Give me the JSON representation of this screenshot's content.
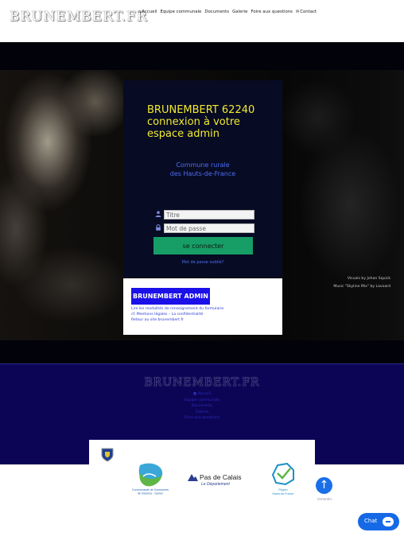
{
  "header": {
    "logo": "BRUNEMBERT.FR",
    "nav": [
      {
        "icon": "home-icon",
        "glyph": "⌂",
        "label": "Accueil"
      },
      {
        "icon": "",
        "glyph": "",
        "label": "Equipe communale"
      },
      {
        "icon": "",
        "glyph": "",
        "label": "Documents"
      },
      {
        "icon": "",
        "glyph": "",
        "label": "Galerie"
      },
      {
        "icon": "",
        "glyph": "",
        "label": "Foire aux questions"
      },
      {
        "icon": "mail-icon",
        "glyph": "✉",
        "label": "Contact"
      }
    ]
  },
  "hero": {
    "credit_visuals": "Visuals by Johan Squick",
    "credit_music": "Music \"Skyline Mix\" by Lavoard"
  },
  "login": {
    "title": "BRUNEMBERT 62240 connexion à votre espace admin",
    "subtitle_line1": "Commune rurale",
    "subtitle_line2": "des Hauts-de-France",
    "username_placeholder": "Titre",
    "password_placeholder": "Mot de passe",
    "submit_label": "se connecter",
    "forgot_label": "Mot de passe oublié?"
  },
  "info": {
    "badge": "BRUNEMBERT ADMIN",
    "link1": "Lire les modalités de renseignement du formulaire",
    "link2": "cf. Mentions légales – La confidentialité",
    "link3": "Retour au site brunembert.fr"
  },
  "footer": {
    "logo": "BRUNEMBERT.FR",
    "links": [
      "■ Accueil",
      "Equipe communale",
      "Documents",
      "Galerie",
      "Foire aux questions"
    ]
  },
  "partners": {
    "ccds_line1": "Communauté de Communes",
    "ccds_line2": "de Desvres - Samer",
    "pdc_name": "Pas de Calais",
    "pdc_sub": "Le Département",
    "hdf_line1": "Région",
    "hdf_line2": "Hauts-de-France"
  },
  "back_to_top": {
    "glyph": "↑",
    "label": "remonter"
  },
  "chat": {
    "label": "Chat"
  },
  "colors": {
    "title_yellow": "#f2ea2f",
    "link_blue": "#4f6df5",
    "button_green": "#169e66",
    "badge_blue": "#1b10e8",
    "footer_navy": "#0c0556",
    "chat_blue": "#1669e6"
  }
}
